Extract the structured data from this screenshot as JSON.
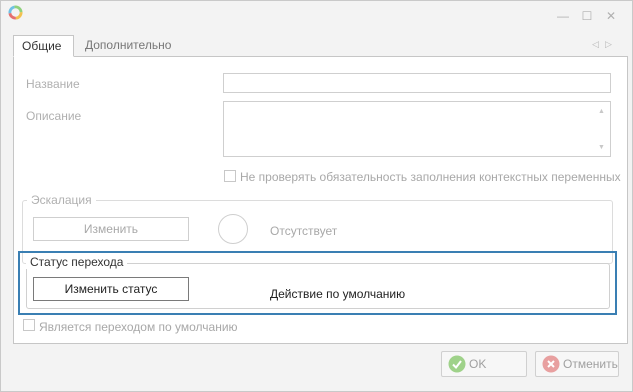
{
  "window": {
    "controls": {
      "minimize": "—",
      "maximize": "☐",
      "close": "✕"
    }
  },
  "tabs": {
    "items": [
      {
        "label": "Общие",
        "active": true
      },
      {
        "label": "Дополнительно",
        "active": false
      }
    ],
    "nav_prev": "◁",
    "nav_next": "▷"
  },
  "form": {
    "name_label": "Название",
    "name_value": "",
    "description_label": "Описание",
    "description_value": "",
    "skip_check_label": "Не проверять обязательность заполнения контекстных переменных",
    "skip_check_checked": false
  },
  "escalation": {
    "title": "Эскалация",
    "change_button": "Изменить",
    "status_text": "Отсутствует"
  },
  "transition_status": {
    "title": "Статус перехода",
    "change_button": "Изменить статус",
    "action_text": "Действие по умолчанию"
  },
  "default_transition": {
    "label": "Является переходом по умолчанию",
    "checked": false
  },
  "footer": {
    "ok_label": "OK",
    "cancel_label": "Отменить"
  },
  "colors": {
    "highlight": "#3a7fb3",
    "ok_icon": "#9fd28a",
    "cancel_icon": "#e8a0a0"
  }
}
